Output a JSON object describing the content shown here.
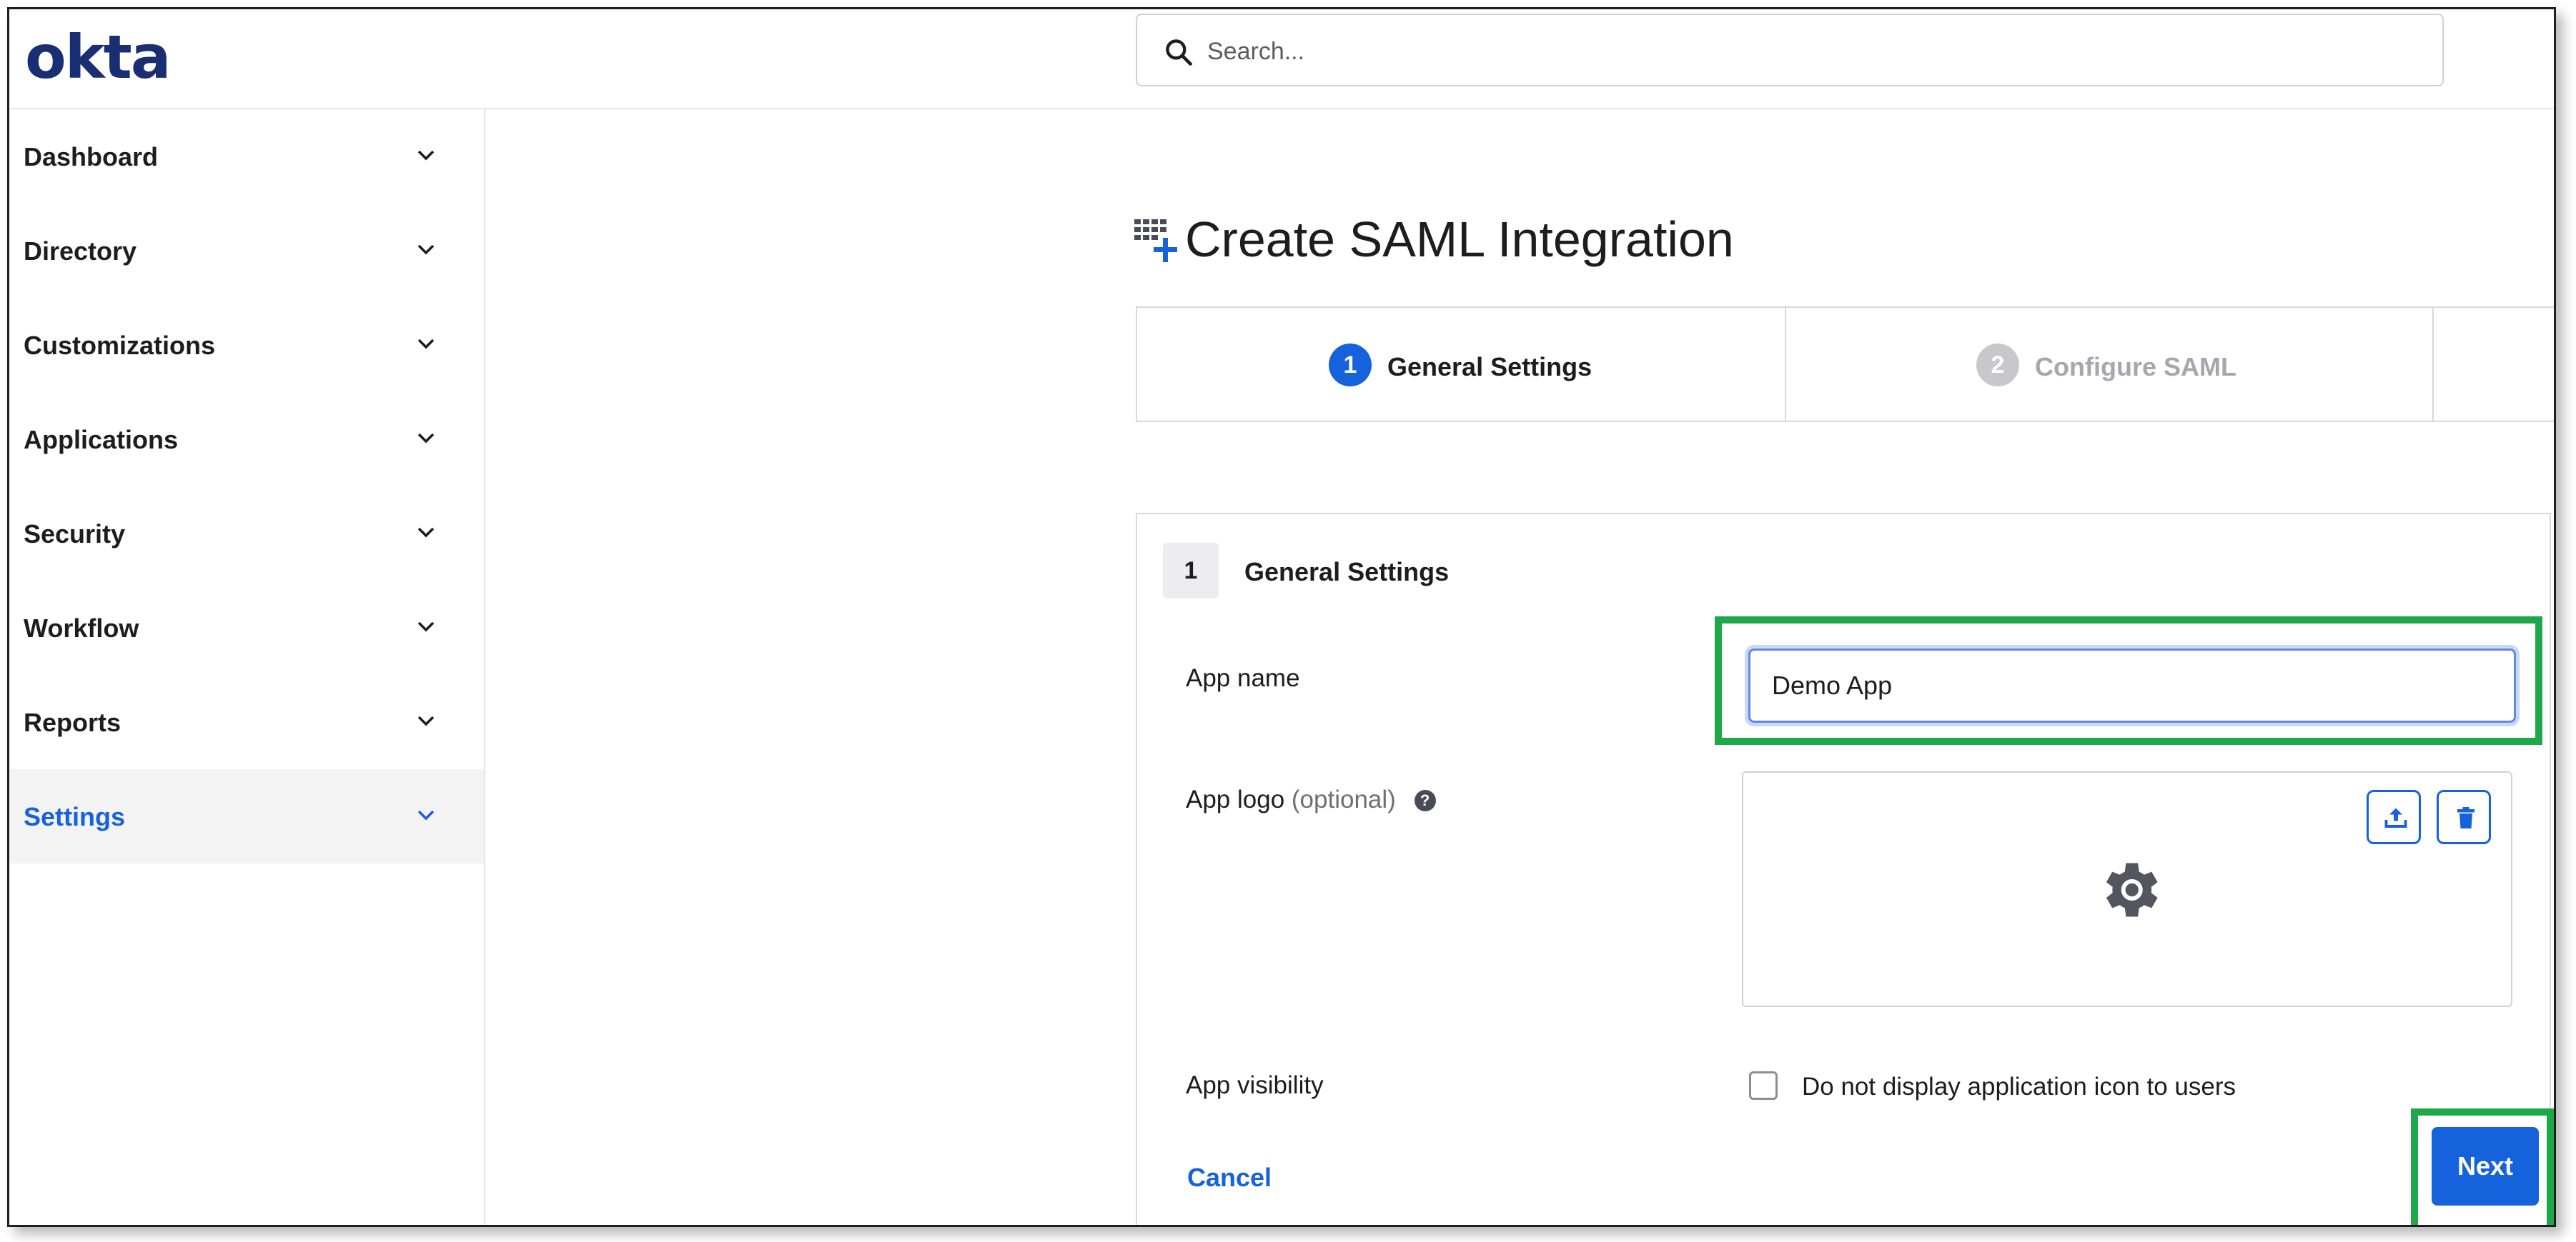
{
  "header": {
    "logo_text": "okta",
    "search_placeholder": "Search..."
  },
  "sidebar": {
    "items": [
      {
        "label": "Dashboard",
        "active": false
      },
      {
        "label": "Directory",
        "active": false
      },
      {
        "label": "Customizations",
        "active": false
      },
      {
        "label": "Applications",
        "active": false
      },
      {
        "label": "Security",
        "active": false
      },
      {
        "label": "Workflow",
        "active": false
      },
      {
        "label": "Reports",
        "active": false
      },
      {
        "label": "Settings",
        "active": true
      }
    ]
  },
  "main": {
    "title": "Create SAML Integration",
    "steps": [
      {
        "number": "1",
        "label": "General Settings",
        "active": true
      },
      {
        "number": "2",
        "label": "Configure SAML",
        "active": false
      }
    ],
    "section": {
      "number": "1",
      "title": "General Settings"
    },
    "fields": {
      "app_name_label": "App name",
      "app_name_value": "Demo App",
      "app_logo_label": "App logo",
      "app_logo_optional": "(optional)",
      "help_icon_text": "?",
      "app_visibility_label": "App visibility",
      "visibility_checkbox_label": "Do not display application icon to users",
      "visibility_checked": false
    },
    "actions": {
      "cancel_label": "Cancel",
      "next_label": "Next"
    }
  },
  "colors": {
    "brand": "#1a2e74",
    "accent": "#1662dd",
    "highlight": "#1ea84a",
    "step_inactive": "#c7c7cc"
  }
}
